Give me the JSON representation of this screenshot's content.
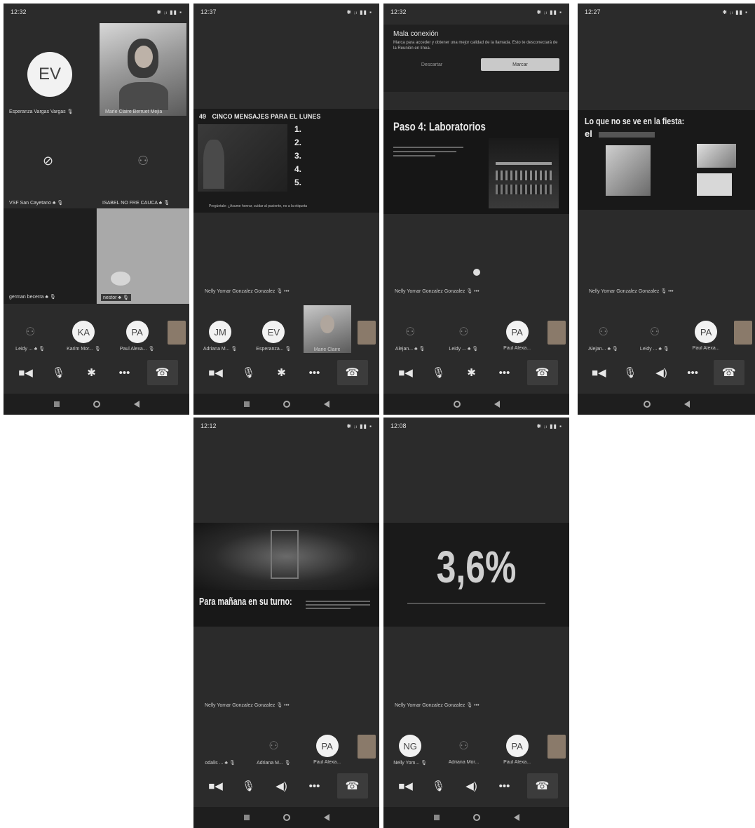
{
  "phones": [
    {
      "time": "12:32",
      "status_icons": "✱ ᵢₗ ▮▮ ▪",
      "tiles": [
        {
          "avatar": "EV",
          "name": "Esperanza Vargas Vargas 🎙"
        },
        {
          "name": "Marie Claire Berruet Mejia"
        },
        {
          "name": "VSF San Cayetano ♣ 🎙"
        },
        {
          "name": "ISABEL NO FRE CAUCA ♣ 🎙"
        },
        {
          "name": "german becerra ♣ 🎙"
        },
        {
          "name": "nestor ♣ 🎙"
        }
      ],
      "participants": [
        {
          "avatar": "",
          "name": "Leidy ... ♣ 🎙"
        },
        {
          "avatar": "KA",
          "name": "Karim Mor... 🎙"
        },
        {
          "avatar": "PA",
          "name": "Paul Alexa... 🎙"
        }
      ]
    },
    {
      "time": "12:37",
      "status_icons": "✱ ᵢₗ ▮▮ ▪",
      "slide_number": "49",
      "slide_title": "CINCO MENSAJES PARA EL LUNES",
      "slide_items": [
        "1.",
        "2.",
        "3.",
        "4.",
        "5."
      ],
      "slide_footer": "Pregúntale: ¿Asume honrar, cuidar al paciente, no a la etiqueta",
      "sharer": "Nelly Yomar Gonzalez Gonzalez 🎙 •••",
      "participants": [
        {
          "avatar": "JM",
          "name": "Adriana M... 🎙"
        },
        {
          "avatar": "EV",
          "name": "Esperanza... 🎙"
        },
        {
          "avatar": "",
          "name": "Marie Claire"
        }
      ]
    },
    {
      "time": "12:32",
      "status_icons": "✱ ᵢₗ ▮▮ ▪",
      "banner_title": "Mala conexión",
      "banner_text": "Marca para acceder y obtener una mejor calidad de la llamada. Esto te desconectará de la Reunión en línea.",
      "dismiss_label": "Descartar",
      "call_label": "Marcar",
      "slide_title": "Paso 4: Laboratorios",
      "sharer": "Nelly Yomar Gonzalez Gonzalez 🎙 •••",
      "participants": [
        {
          "avatar": "",
          "name": "Alejan... ♣ 🎙"
        },
        {
          "avatar": "",
          "name": "Leidy ... ♣ 🎙"
        },
        {
          "avatar": "PA",
          "name": "Paul Alexa..."
        }
      ]
    },
    {
      "time": "12:27",
      "status_icons": "✱ ᵢₗ ▮▮ ▪",
      "slide_title": "Lo que no se ve en la fiesta:",
      "slide_subtitle": "el",
      "sharer": "Nelly Yomar Gonzalez Gonzalez 🎙 •••",
      "participants": [
        {
          "avatar": "",
          "name": "Alejan... ♣ 🎙"
        },
        {
          "avatar": "",
          "name": "Leidy ... ♣ 🎙"
        },
        {
          "avatar": "PA",
          "name": "Paul Alexa..."
        }
      ]
    },
    {
      "time": "12:12",
      "status_icons": "✱ ᵢₗ ▮▮ ▪",
      "slide_title": "Para mañana en su turno:",
      "sharer": "Nelly Yomar Gonzalez Gonzalez 🎙 •••",
      "participants": [
        {
          "avatar": "",
          "name": "odalis ... ♣ 🎙"
        },
        {
          "avatar": "",
          "name": "Adriana M... 🎙"
        },
        {
          "avatar": "PA",
          "name": "Paul Alexa..."
        }
      ]
    },
    {
      "time": "12:08",
      "status_icons": "✱ ᵢₗ ▮▮ ▪",
      "big_stat": "3,6%",
      "sharer": "Nelly Yomar Gonzalez Gonzalez 🎙 •••",
      "participants": [
        {
          "avatar": "NG",
          "name": "Nelly Yom... 🎙"
        },
        {
          "avatar": "",
          "name": "Adriana Mor..."
        },
        {
          "avatar": "PA",
          "name": "Paul Alexa..."
        }
      ]
    }
  ]
}
